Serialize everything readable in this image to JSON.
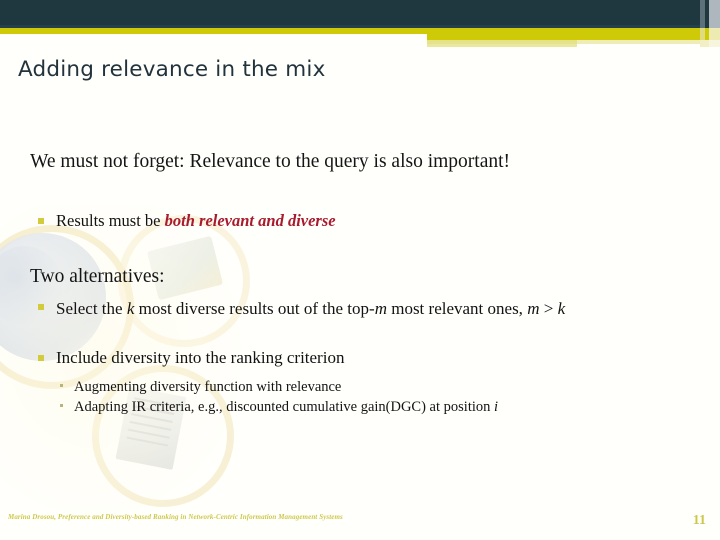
{
  "slide": {
    "title": "Adding relevance in the mix",
    "page_number": "11",
    "footer": "Marina Drosou, Preference and Diversity-based Ranking in Network-Centric Information Management Systems",
    "colors": {
      "banner_dark": "#1f3840",
      "banner_yellow": "#cfca07",
      "banner_pale": "#e6e28a",
      "title_text": "#22333c",
      "accent_red": "#a81b2d",
      "bullet_square": "#d2cc3c",
      "footer_text": "#cdc84a"
    }
  },
  "content": {
    "lead_paragraph": "We must not forget: Relevance to the query is also important!",
    "results_bullet": {
      "prefix": "Results must be ",
      "emphasis": "both relevant and diverse"
    },
    "two_alternatives_heading": "Two alternatives:",
    "alternatives": [
      {
        "parts": {
          "p1": "Select the ",
          "v1": "k",
          "p2": " most diverse results out of the top-",
          "v2": "m",
          "p3": " most relevant ones, ",
          "v3": "m",
          "p4": " > ",
          "v4": "k"
        }
      },
      {
        "text": "Include diversity into the ranking criterion",
        "subitems": [
          {
            "text": "Augmenting diversity function with relevance"
          },
          {
            "prefix": "Adapting IR criteria, e.g., discounted cumulative gain(DGC) at position ",
            "variable": "i"
          }
        ]
      }
    ]
  }
}
